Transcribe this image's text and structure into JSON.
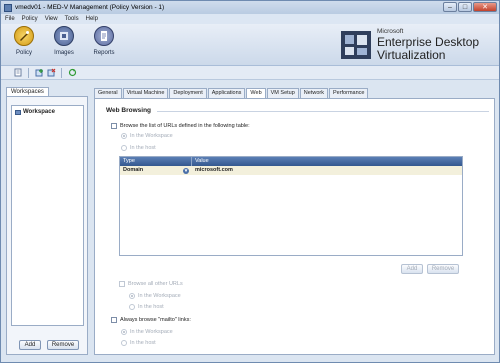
{
  "window": {
    "title": "vmedv01 - MED-V Management (Policy Version - 1)"
  },
  "menu": [
    "File",
    "Policy",
    "View",
    "Tools",
    "Help"
  ],
  "ribbon": {
    "buttons": [
      {
        "label": "Policy",
        "icon": "policy-icon"
      },
      {
        "label": "Images",
        "icon": "images-icon"
      },
      {
        "label": "Reports",
        "icon": "reports-icon"
      }
    ],
    "brand": {
      "company": "Microsoft",
      "line1": "Enterprise Desktop",
      "line2": "Virtualization"
    }
  },
  "toolbar": {
    "icons": [
      "properties-icon",
      "add-workspace-icon",
      "delete-workspace-icon",
      "refresh-icon"
    ]
  },
  "left": {
    "tab": "Workspaces",
    "tree_item": "Workspace",
    "add_label": "Add",
    "remove_label": "Remove"
  },
  "tabs": [
    "General",
    "Virtual Machine",
    "Deployment",
    "Applications",
    "Web",
    "VM Setup",
    "Network",
    "Performance"
  ],
  "active_tab": "Web",
  "web": {
    "section_title": "Web Browsing",
    "browse_list_label": "Browse the list of URLs defined in the following table:",
    "in_workspace": "In the Workspace",
    "in_host": "In the host",
    "table": {
      "columns": [
        "Type",
        "Value"
      ],
      "rows": [
        {
          "type": "Domain",
          "value": "microsoft.com"
        }
      ]
    },
    "add_label": "Add",
    "remove_label": "Remove",
    "browse_all_label": "Browse all other URLs",
    "mailto_label": "Always browse \"mailto\" links:"
  }
}
